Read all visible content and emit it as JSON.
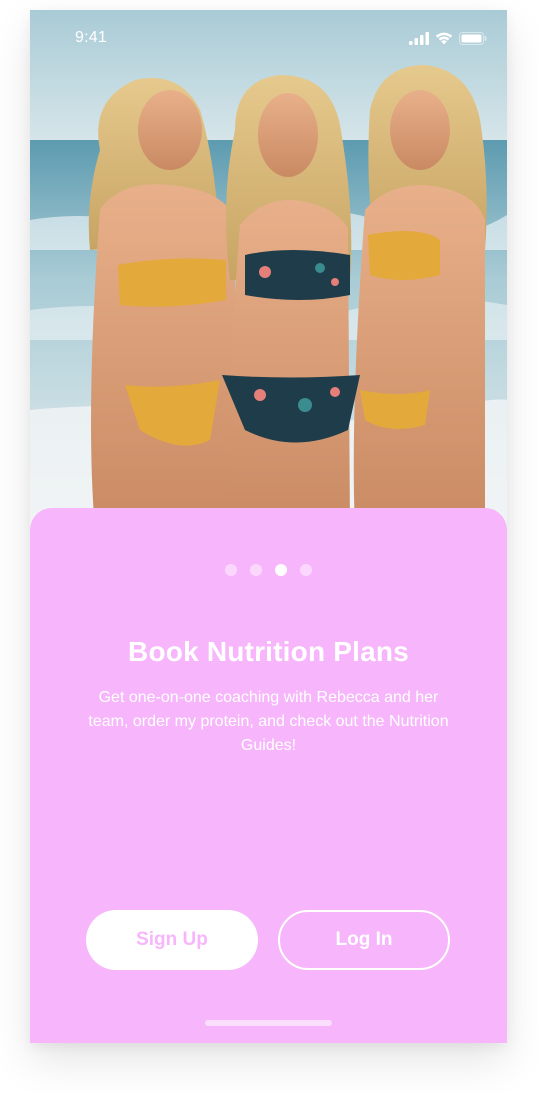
{
  "status_bar": {
    "time": "9:41",
    "icons": [
      "cellular-signal-icon",
      "wifi-icon",
      "battery-icon"
    ]
  },
  "hero": {
    "description_icon": "hero-photo"
  },
  "onboarding": {
    "pagination": {
      "total": 4,
      "active_index": 2
    },
    "title": "Book Nutrition Plans",
    "body": "Get one-on-one coaching with Rebecca and her team, order my protein, and check out the Nutrition Guides!"
  },
  "actions": {
    "signup_label": "Sign Up",
    "login_label": "Log In"
  },
  "colors": {
    "accent_pink": "#f7b6fb",
    "white": "#ffffff"
  }
}
